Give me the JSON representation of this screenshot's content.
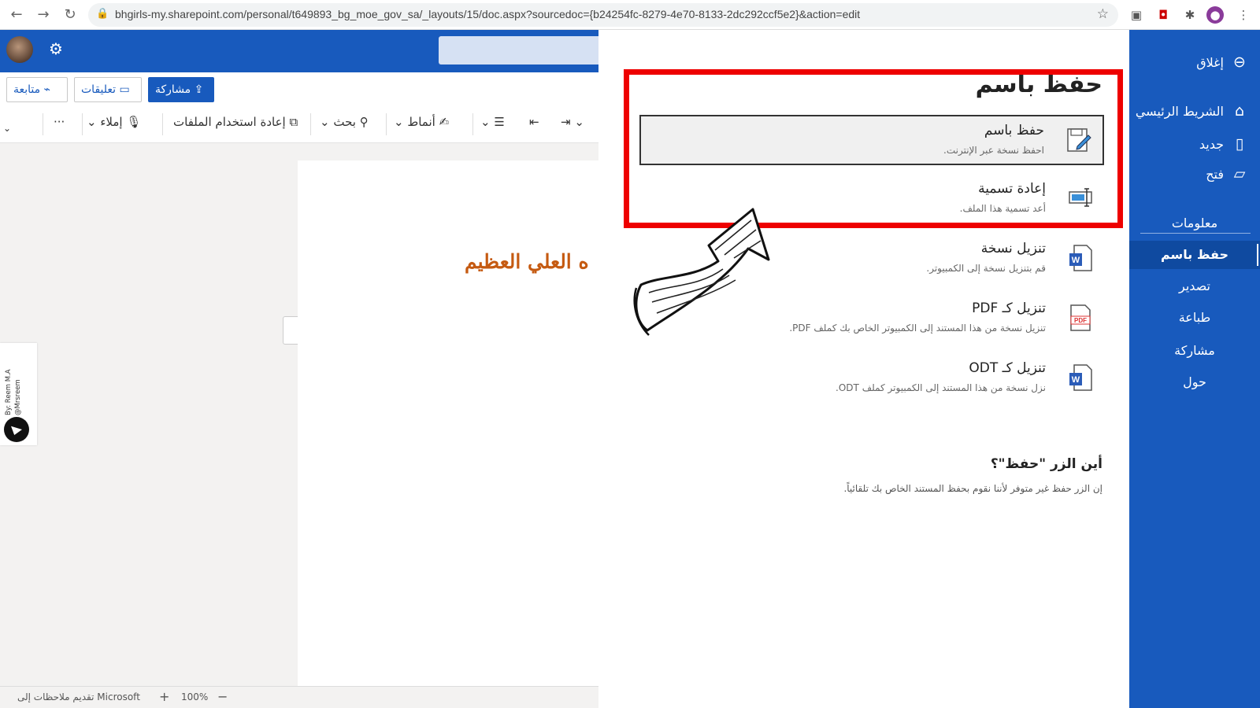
{
  "browser": {
    "url": "bhgirls-my.sharepoint.com/personal/t649893_bg_moe_gov_sa/_layouts/15/doc.aspx?sourcedoc={b24254fc-8279-4e70-8133-2dc292ccf5e2}&action=edit"
  },
  "header": {
    "follow_label": "متابعة",
    "comments_label": "تعليقات",
    "share_label": "مشاركة"
  },
  "ribbon": {
    "more": "···",
    "dictate": "إملاء",
    "reuse_files": "إعادة استخدام الملفات",
    "search": "بحث",
    "styles": "أنماط"
  },
  "document": {
    "heading": "ه العلي العظيم"
  },
  "watermark": {
    "line1": "By: Reem M.A",
    "line2": "@Mrsreem"
  },
  "status_bar": {
    "feedback": "تقديم ملاحظات إلى Microsoft",
    "zoom": "100%",
    "zoom_in": "+",
    "zoom_out": "−"
  },
  "backstage": {
    "title": "حفظ باسم",
    "options": [
      {
        "title": "حفظ باسم",
        "desc": "احفظ نسخة عبر الإنترنت.",
        "icon": "save-as-icon"
      },
      {
        "title": "إعادة تسمية",
        "desc": "أعد تسمية هذا الملف.",
        "icon": "rename-icon"
      },
      {
        "title": "تنزيل نسخة",
        "desc": "قم بتنزيل نسخة إلى الكمبيوتر.",
        "icon": "word-doc-icon"
      },
      {
        "title": "تنزيل كـ PDF",
        "desc": "تنزيل نسخة من هذا المستند إلى الكمبيوتر الخاص بك كملف PDF.",
        "icon": "pdf-icon"
      },
      {
        "title": "تنزيل كـ ODT",
        "desc": "نزل نسخة من هذا المستند إلى الكمبيوتر كملف ODT.",
        "icon": "odt-icon"
      }
    ],
    "where_title": "أين الزر \"حفظ\"؟",
    "where_desc": "إن الزر حفظ غير متوفر لأننا نقوم بحفظ المستند الخاص بك تلقائياً."
  },
  "sidebar": {
    "close": "إغلاق",
    "home": "الشريط الرئيسي",
    "new": "جديد",
    "open": "فتح",
    "sections": [
      "معلومات",
      "حفظ باسم",
      "تصدير",
      "طباعة",
      "مشاركة",
      "حول"
    ],
    "active_section": "حفظ باسم"
  },
  "colors": {
    "brand_blue": "#185abd",
    "highlight_red": "#e00000",
    "heading_orange": "#c55a11"
  }
}
